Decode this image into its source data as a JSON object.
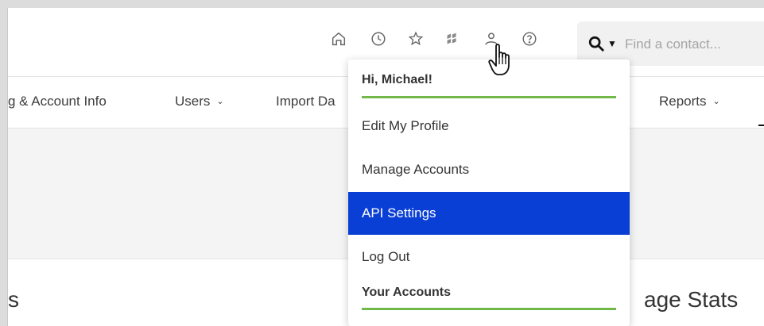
{
  "header": {
    "icons": [
      "home-icon",
      "history-icon",
      "favorites-icon",
      "logo-icon",
      "user-icon",
      "help-icon"
    ],
    "search": {
      "placeholder": "Find a contact..."
    }
  },
  "nav": {
    "items": [
      {
        "label": "g & Account Info",
        "has_chevron": false
      },
      {
        "label": "Users",
        "has_chevron": true,
        "chevron": "⌄"
      },
      {
        "label": "Import Da",
        "has_chevron": false
      },
      {
        "label": "Reports",
        "has_chevron": true,
        "chevron": "⌄"
      }
    ]
  },
  "content": {
    "left_heading_fragment": "s",
    "right_heading_fragment": "age Stats"
  },
  "user_menu": {
    "greeting": "Hi, Michael!",
    "items": [
      {
        "label": "Edit My Profile",
        "active": false
      },
      {
        "label": "Manage Accounts",
        "active": false
      },
      {
        "label": "API Settings",
        "active": true
      },
      {
        "label": "Log Out",
        "active": false
      }
    ],
    "accounts_heading": "Your Accounts"
  },
  "colors": {
    "accent_blue": "#0a3fd6",
    "underline_green": "#72b94a",
    "band_grey": "#f4f4f4"
  }
}
